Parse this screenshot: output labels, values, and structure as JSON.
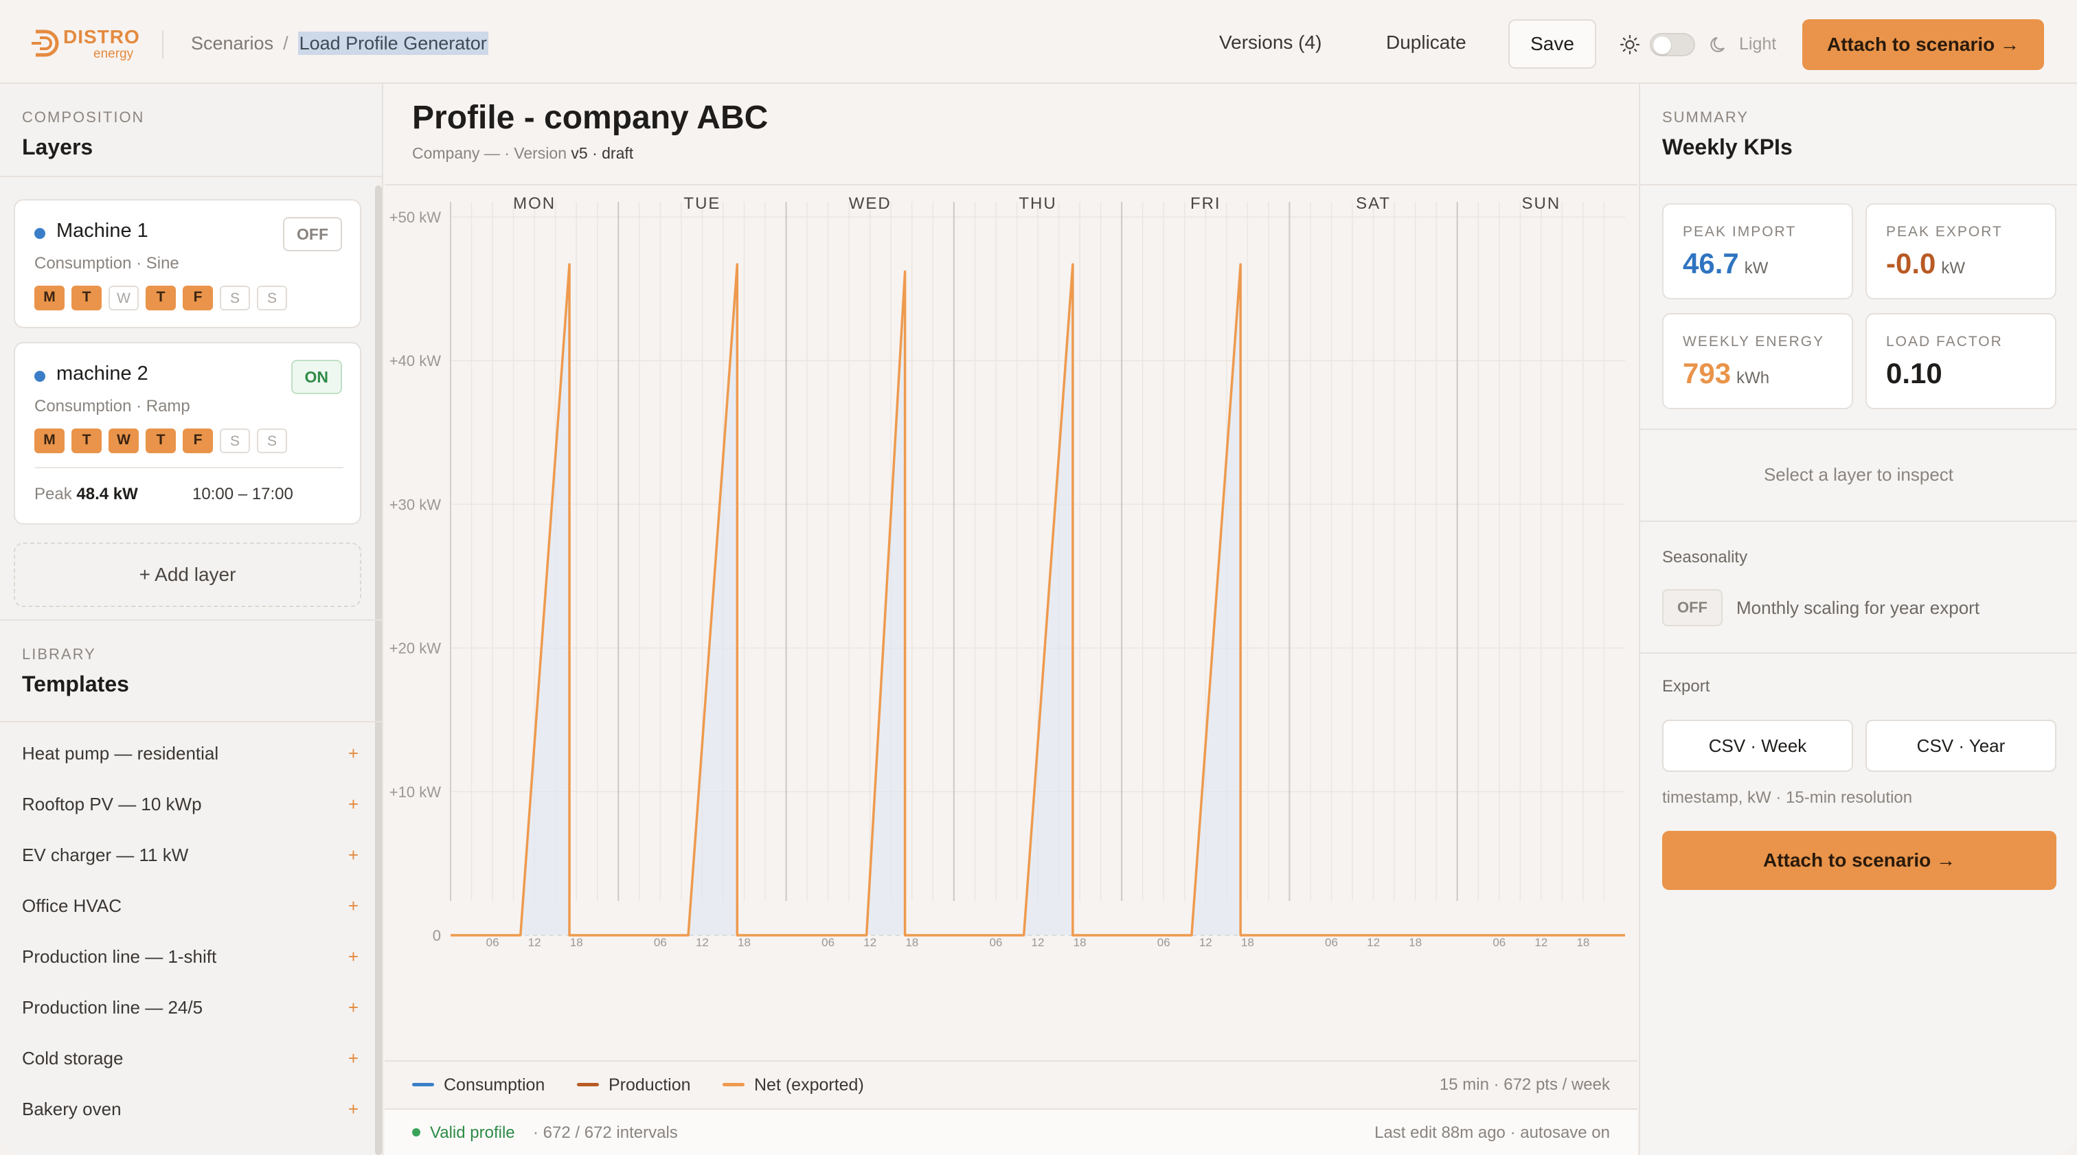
{
  "brand": {
    "name": "DISTRO",
    "sub": "energy",
    "color": "#e48a3f"
  },
  "breadcrumb": {
    "parent": "Scenarios",
    "separator": "/",
    "current": "Load Profile Generator"
  },
  "header": {
    "versions_label": "Versions (4)",
    "duplicate_label": "Duplicate",
    "save_label": "Save",
    "theme_label": "Light",
    "attach_label": "Attach to scenario →"
  },
  "composition": {
    "eyebrow": "COMPOSITION",
    "title": "Layers",
    "layers": [
      {
        "name": "Machine 1",
        "subtitle": "Consumption · Sine",
        "state": "OFF",
        "days": [
          {
            "label": "M",
            "on": true
          },
          {
            "label": "T",
            "on": true
          },
          {
            "label": "W",
            "on": false
          },
          {
            "label": "T",
            "on": true
          },
          {
            "label": "F",
            "on": true
          },
          {
            "label": "S",
            "on": false
          },
          {
            "label": "S",
            "on": false
          }
        ]
      },
      {
        "name": "machine 2",
        "subtitle": "Consumption · Ramp",
        "state": "ON",
        "days": [
          {
            "label": "M",
            "on": true
          },
          {
            "label": "T",
            "on": true
          },
          {
            "label": "W",
            "on": true
          },
          {
            "label": "T",
            "on": true
          },
          {
            "label": "F",
            "on": true
          },
          {
            "label": "S",
            "on": false
          },
          {
            "label": "S",
            "on": false
          }
        ],
        "peak_label": "Peak",
        "peak_value": "48.4 kW",
        "hours": "10:00 – 17:00"
      }
    ],
    "add_layer_label": "+ Add layer"
  },
  "library": {
    "eyebrow": "LIBRARY",
    "title": "Templates",
    "add_symbol": "+",
    "templates": [
      "Heat pump — residential",
      "Rooftop PV — 10 kWp",
      "EV charger — 11 kW",
      "Office HVAC",
      "Production line — 1-shift",
      "Production line — 24/5",
      "Cold storage",
      "Bakery oven"
    ]
  },
  "profile": {
    "title": "Profile - company ABC",
    "meta_prefix": "Company — · Version",
    "version": "v5",
    "meta_suffix": "· draft"
  },
  "chart_data": {
    "type": "line",
    "days": [
      "MON",
      "TUE",
      "WED",
      "THU",
      "FRI",
      "SAT",
      "SUN"
    ],
    "hour_ticks": [
      "06",
      "12",
      "18"
    ],
    "y_ticks": [
      "0",
      "+10 kW",
      "+20 kW",
      "+30 kW",
      "+40 kW",
      "+50 kW"
    ],
    "ylim": [
      0,
      50
    ],
    "unit": "kW",
    "series": [
      {
        "name": "Net (exported)",
        "color": "#ee9a4e",
        "shape": "ramp",
        "days_active": [
          "MON",
          "TUE",
          "WED",
          "THU",
          "FRI"
        ],
        "ramp_start_hour": [
          10,
          10,
          11.5,
          10,
          10
        ],
        "peak_hour": [
          17,
          17,
          17,
          17,
          17
        ],
        "peak_kw": [
          46.7,
          46.7,
          46.2,
          46.7,
          46.7
        ],
        "base_kw": 0
      }
    ],
    "grid": true
  },
  "legend": [
    {
      "label": "Consumption",
      "color": "#3b7ec8"
    },
    {
      "label": "Production",
      "color": "#b85a23"
    },
    {
      "label": "Net (exported)",
      "color": "#ee9a4e"
    }
  ],
  "resolution": "15 min · 672 pts / week",
  "status": {
    "valid_label": "Valid profile",
    "intervals": "· 672 / 672 intervals",
    "last_edit": "Last edit 88m ago · autosave on"
  },
  "summary": {
    "eyebrow": "SUMMARY",
    "title": "Weekly KPIs",
    "kpis": [
      {
        "label": "PEAK IMPORT",
        "value": "46.7",
        "unit": "kW",
        "color": "#2f74c0"
      },
      {
        "label": "PEAK EXPORT",
        "value": "-0.0",
        "unit": "kW",
        "color": "#b85a23"
      },
      {
        "label": "WEEKLY ENERGY",
        "value": "793",
        "unit": "kWh",
        "color": "#e9944a"
      },
      {
        "label": "LOAD FACTOR",
        "value": "0.10",
        "unit": "",
        "color": "#1f1d1b"
      }
    ],
    "inspect_hint": "Select a layer to inspect",
    "seasonality_label": "Seasonality",
    "seasonality_state": "OFF",
    "seasonality_text": "Monthly scaling for year export",
    "export_label": "Export",
    "csv_week": "CSV · Week",
    "csv_year": "CSV · Year",
    "export_note": "timestamp, kW · 15-min resolution",
    "attach_label": "Attach to scenario →"
  }
}
